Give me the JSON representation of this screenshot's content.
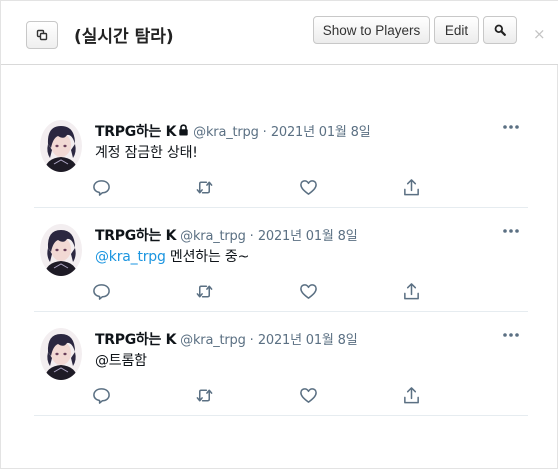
{
  "titlebar": {
    "title": "(실시간 탐라)",
    "show_players_label": "Show to Players",
    "edit_label": "Edit",
    "close_glyph": "×",
    "icons": {
      "popout": "popout-icon",
      "search": "search-icon",
      "close": "close-icon"
    }
  },
  "tweets": [
    {
      "name": "TRPG하는 K",
      "locked": true,
      "handle": "@kra_trpg",
      "separator": "·",
      "date": "2021년 01월 8일",
      "text": "계정 잠금한 상태!",
      "mention": ""
    },
    {
      "name": "TRPG하는 K",
      "locked": false,
      "handle": "@kra_trpg",
      "separator": "·",
      "date": "2021년 01월 8일",
      "mention": "@kra_trpg",
      "text": " 멘션하는 중~"
    },
    {
      "name": "TRPG하는 K",
      "locked": false,
      "handle": "@kra_trpg",
      "separator": "·",
      "date": "2021년 01월 8일",
      "text": "@트롬함",
      "mention": ""
    }
  ],
  "colors": {
    "accent": "#1b95e0",
    "muted": "#5b7083",
    "divider": "#e6ecf0"
  }
}
